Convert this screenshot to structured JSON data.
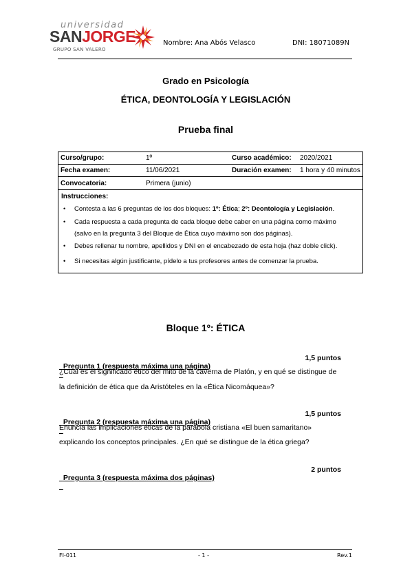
{
  "header": {
    "logo_university": "universidad",
    "logo_san": "SAN",
    "logo_jorge": "JORGE",
    "logo_group": "GRUPO SAN VALERO",
    "logo_icon": "star-burst-icon",
    "name_field": "Nombre: Ana Abós Velasco",
    "dni_field": "DNI: 18071089N",
    "brand_color": "#d2232a"
  },
  "titles": {
    "degree": "Grado en Psicología",
    "subject": "ÉTICA, DEONTOLOGÍA Y LEGISLACIÓN",
    "exam": "Prueba final"
  },
  "info": {
    "course_label": "Curso/grupo:",
    "course_value": "1º",
    "academic_year_label": "Curso académico:",
    "academic_year_value": "2020/2021",
    "exam_date_label": "Fecha examen:",
    "exam_date_value": "11/06/2021",
    "duration_label": "Duración examen:",
    "duration_value": "1 hora y 40 minutos",
    "call_label": "Convocatoria:",
    "call_value": "Primera (junio)",
    "instructions_label": "Instrucciones:",
    "bullet_symbol": "•",
    "instructions": {
      "i1_pre": "Contesta a las 6 preguntas de los dos bloques: ",
      "i1_b1": "1º: Ética",
      "i1_sep": "; ",
      "i1_b2": "2º: Deontología y Legislación",
      "i1_end": ".",
      "i2_l1": "Cada respuesta a cada pregunta de cada bloque debe caber en una página como máximo",
      "i2_l2": "(salvo en la pregunta 3 del Bloque de Ética cuyo máximo son dos páginas).",
      "i3": "Debes rellenar tu nombre, apellidos y DNI en el encabezado de esta hoja (haz doble click).",
      "i4": "Si necesitas algún justificante, pídelo a tus profesores antes de comenzar la prueba."
    }
  },
  "block": {
    "title": "Bloque 1º: ÉTICA",
    "questions": [
      {
        "heading": "Pregunta 1 (respuesta máxima una página)",
        "points": "1,5 puntos",
        "lines": [
          "¿Cuál es el significado ético del mito de la caverna de Platón, y en qué se distingue de",
          "la definición de ética que da Aristóteles en la «Ética Nicomáquea»?"
        ]
      },
      {
        "heading": "Pregunta 2 (respuesta máxima una página)",
        "points": "1,5 puntos",
        "lines": [
          "Enuncia las implicaciones éticas de la parábola cristiana «El buen samaritano»",
          "explicando los conceptos principales. ¿En qué se distingue de la ética griega?"
        ]
      },
      {
        "heading": "Pregunta 3 (respuesta máxima dos páginas)",
        "points": "2 puntos",
        "lines": []
      }
    ]
  },
  "footer": {
    "code": "FI-011",
    "page": "- 1 -",
    "rev": "Rev.1"
  }
}
